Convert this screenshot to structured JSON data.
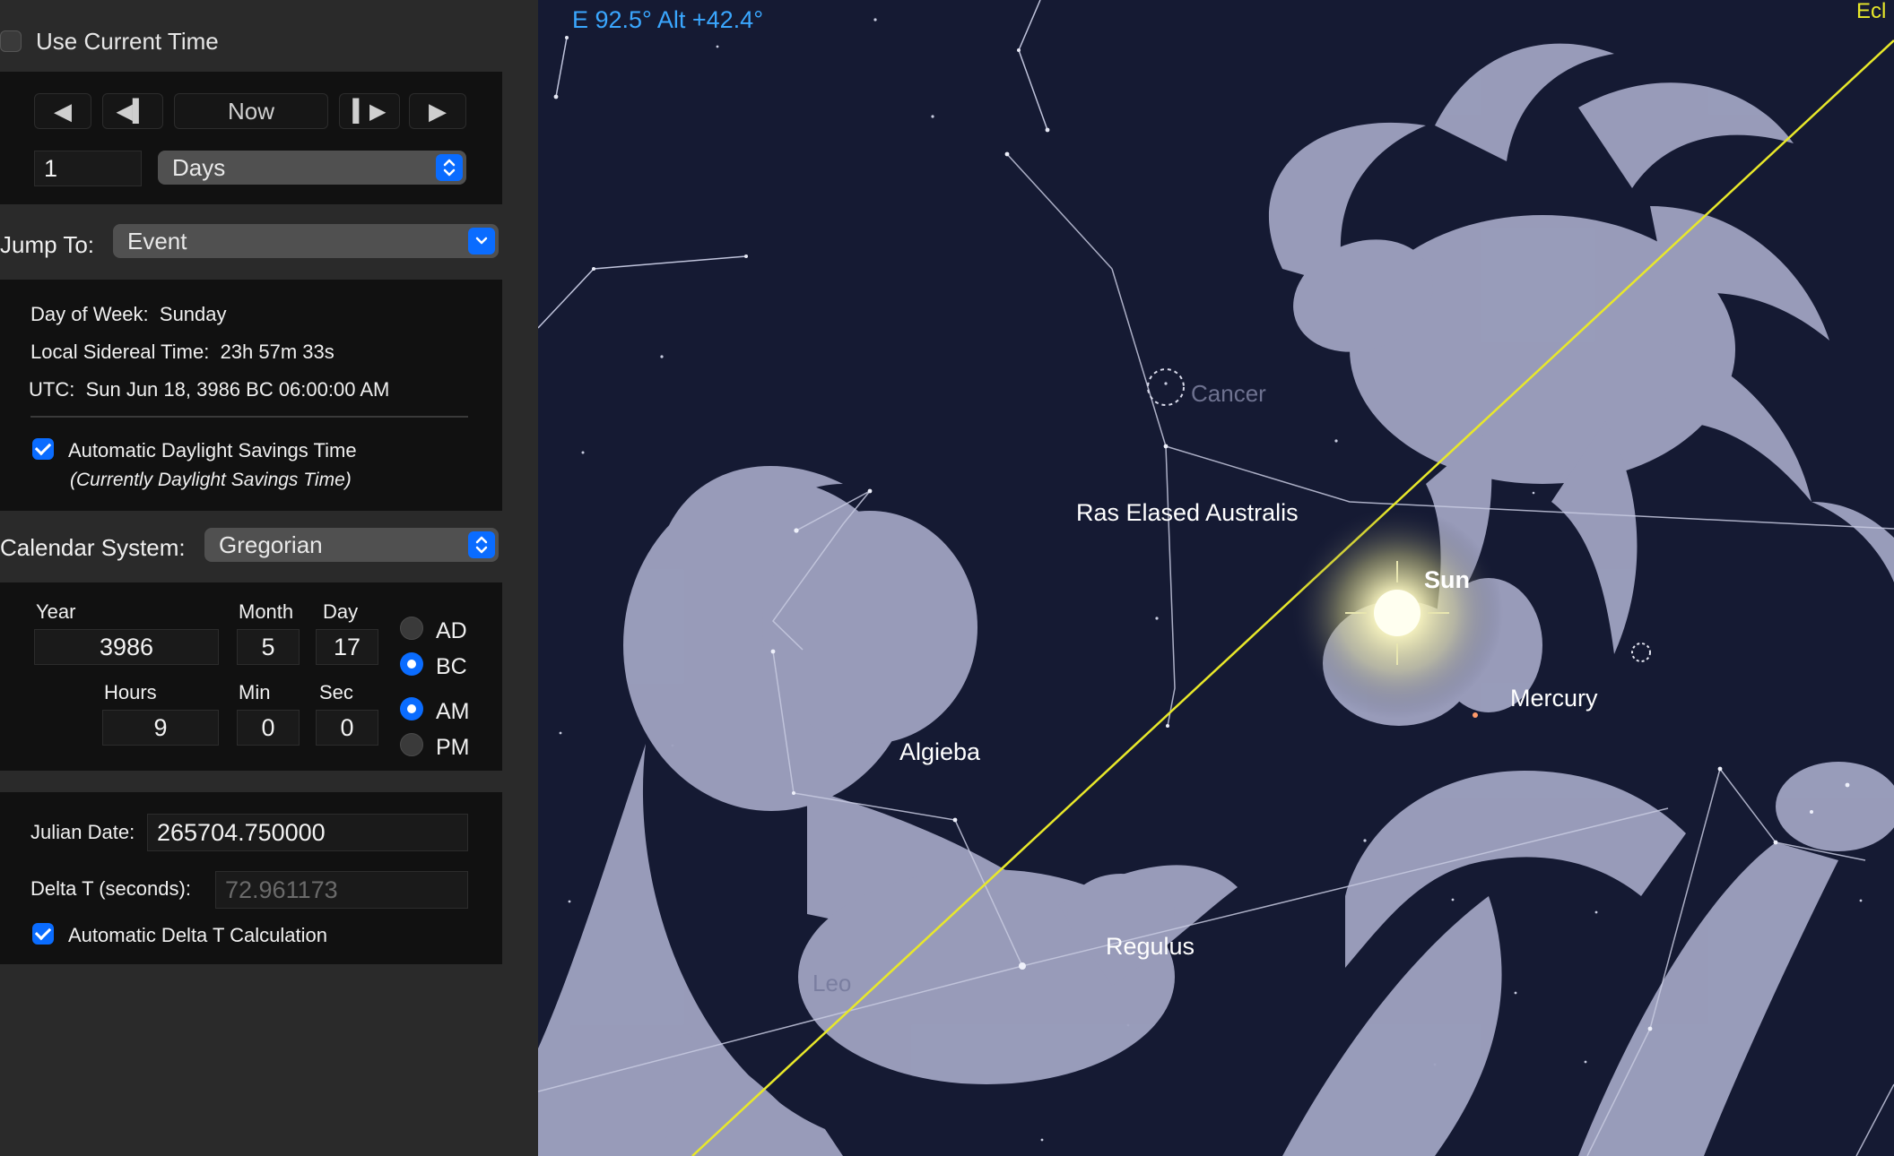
{
  "panel": {
    "use_current_time": {
      "label": "Use Current Time",
      "checked": false
    },
    "step_controls": {
      "now_label": "Now",
      "step_value": "1",
      "step_unit": "Days"
    },
    "jump_to": {
      "label": "Jump To:",
      "value": "Event"
    },
    "info": {
      "day_of_week_label": "Day of Week:",
      "day_of_week": "Sunday",
      "sidereal_label": "Local Sidereal Time:",
      "sidereal": "23h 57m 33s",
      "utc_label": "UTC:",
      "utc": "Sun Jun 18, 3986 BC 06:00:00 AM",
      "auto_dst_label": "Automatic Daylight Savings Time",
      "auto_dst_checked": true,
      "dst_status": "(Currently Daylight Savings Time)"
    },
    "calendar": {
      "label": "Calendar System:",
      "value": "Gregorian"
    },
    "date": {
      "year_label": "Year",
      "year": "3986",
      "month_label": "Month",
      "month": "5",
      "day_label": "Day",
      "day": "17",
      "hours_label": "Hours",
      "hours": "9",
      "min_label": "Min",
      "min": "0",
      "sec_label": "Sec",
      "sec": "0",
      "ad_label": "AD",
      "bc_label": "BC",
      "era_selected": "BC",
      "am_label": "AM",
      "pm_label": "PM",
      "meridiem_selected": "AM"
    },
    "julian": {
      "julian_label": "Julian Date:",
      "julian_value": "265704.750000",
      "delta_t_label": "Delta T (seconds):",
      "delta_t_value": "72.961173",
      "auto_delta_label": "Automatic Delta T Calculation",
      "auto_delta_checked": true
    }
  },
  "sky": {
    "coords": "E 92.5° Alt +42.4°",
    "ecliptic_label": "Ecl",
    "labels": {
      "ras_elased": "Ras Elased Australis",
      "sun": "Sun",
      "mercury": "Mercury",
      "algieba": "Algieba",
      "regulus": "Regulus",
      "leo": "Leo",
      "cancer": "Cancer"
    },
    "colors": {
      "background": "#151a33",
      "figures": "#9ea1bf",
      "ecliptic": "#e8e82a",
      "coords": "#3aa7ff"
    }
  }
}
